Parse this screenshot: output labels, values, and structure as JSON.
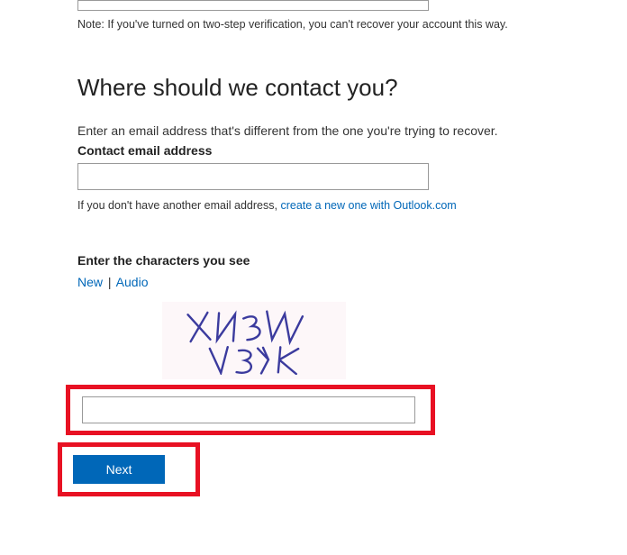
{
  "note": "Note: If you've turned on two-step verification, you can't recover your account this way.",
  "heading": "Where should we contact you?",
  "instruction": "Enter an email address that's different from the one you're trying to recover.",
  "emailLabel": "Contact email address",
  "helperPrefix": "If you don't have another email address, ",
  "helperLink": "create a new one with Outlook.com",
  "captcha": {
    "label": "Enter the characters you see",
    "newLink": "New",
    "divider": "|",
    "audioLink": "Audio",
    "distortedText": "XN3W V3YK"
  },
  "nextButton": "Next"
}
